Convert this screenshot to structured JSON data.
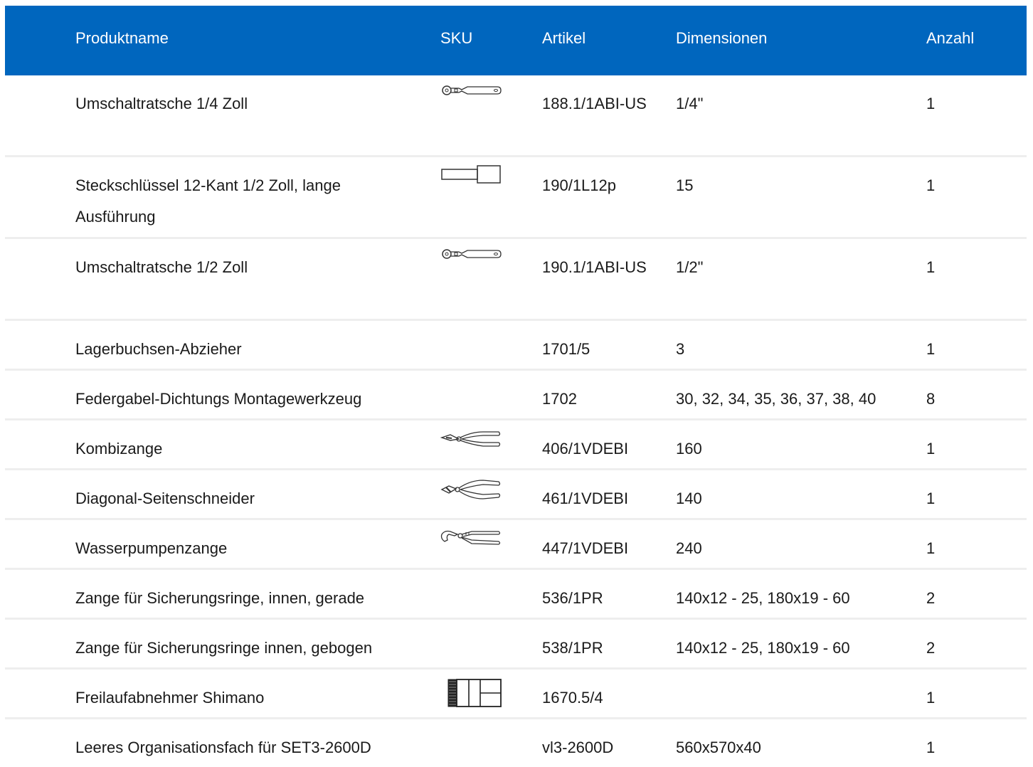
{
  "headers": {
    "name": "Produktname",
    "sku": "SKU",
    "article": "Artikel",
    "dimensions": "Dimensionen",
    "quantity": "Anzahl"
  },
  "rows": [
    {
      "name": "Umschaltratsche 1/4 Zoll",
      "sku_icon": "ratchet-icon",
      "article": "188.1/1ABI-US",
      "dimensions": "1/4\"",
      "quantity": "1"
    },
    {
      "name": "Steckschlüssel 12-Kant 1/2 Zoll, lange Ausführung",
      "sku_icon": "socket-icon",
      "article": "190/1L12p",
      "dimensions": "15",
      "quantity": "1"
    },
    {
      "name": "Umschaltratsche 1/2 Zoll",
      "sku_icon": "ratchet-icon",
      "article": "190.1/1ABI-US",
      "dimensions": "1/2\"",
      "quantity": "1"
    },
    {
      "name": "Lagerbuchsen-Abzieher",
      "sku_icon": "",
      "article": "1701/5",
      "dimensions": "3",
      "quantity": "1"
    },
    {
      "name": "Federgabel-Dichtungs Montagewerkzeug",
      "sku_icon": "",
      "article": "1702",
      "dimensions": "30, 32, 34, 35, 36, 37, 38, 40",
      "quantity": "8"
    },
    {
      "name": "Kombizange",
      "sku_icon": "combination-pliers-icon",
      "article": "406/1VDEBI",
      "dimensions": "160",
      "quantity": "1"
    },
    {
      "name": "Diagonal-Seitenschneider",
      "sku_icon": "diagonal-cutter-icon",
      "article": "461/1VDEBI",
      "dimensions": "140",
      "quantity": "1"
    },
    {
      "name": "Wasserpumpenzange",
      "sku_icon": "water-pump-pliers-icon",
      "article": "447/1VDEBI",
      "dimensions": "240",
      "quantity": "1"
    },
    {
      "name": "Zange für Sicherungsringe, innen, gerade",
      "sku_icon": "",
      "article": "536/1PR",
      "dimensions": "140x12 - 25, 180x19 - 60",
      "quantity": "2"
    },
    {
      "name": "Zange für Sicherungsringe innen, gebogen",
      "sku_icon": "",
      "article": "538/1PR",
      "dimensions": "140x12 - 25, 180x19 - 60",
      "quantity": "2"
    },
    {
      "name": "Freilaufabnehmer Shimano",
      "sku_icon": "freewheel-remover-icon",
      "article": "1670.5/4",
      "dimensions": "",
      "quantity": "1"
    },
    {
      "name": "Leeres Organisationsfach für SET3-2600D",
      "sku_icon": "",
      "article": "vl3-2600D",
      "dimensions": "560x570x40",
      "quantity": "1"
    }
  ],
  "colors": {
    "header_bg": "#0066be",
    "header_text": "#ffffff",
    "row_divider": "#eeeeee"
  }
}
